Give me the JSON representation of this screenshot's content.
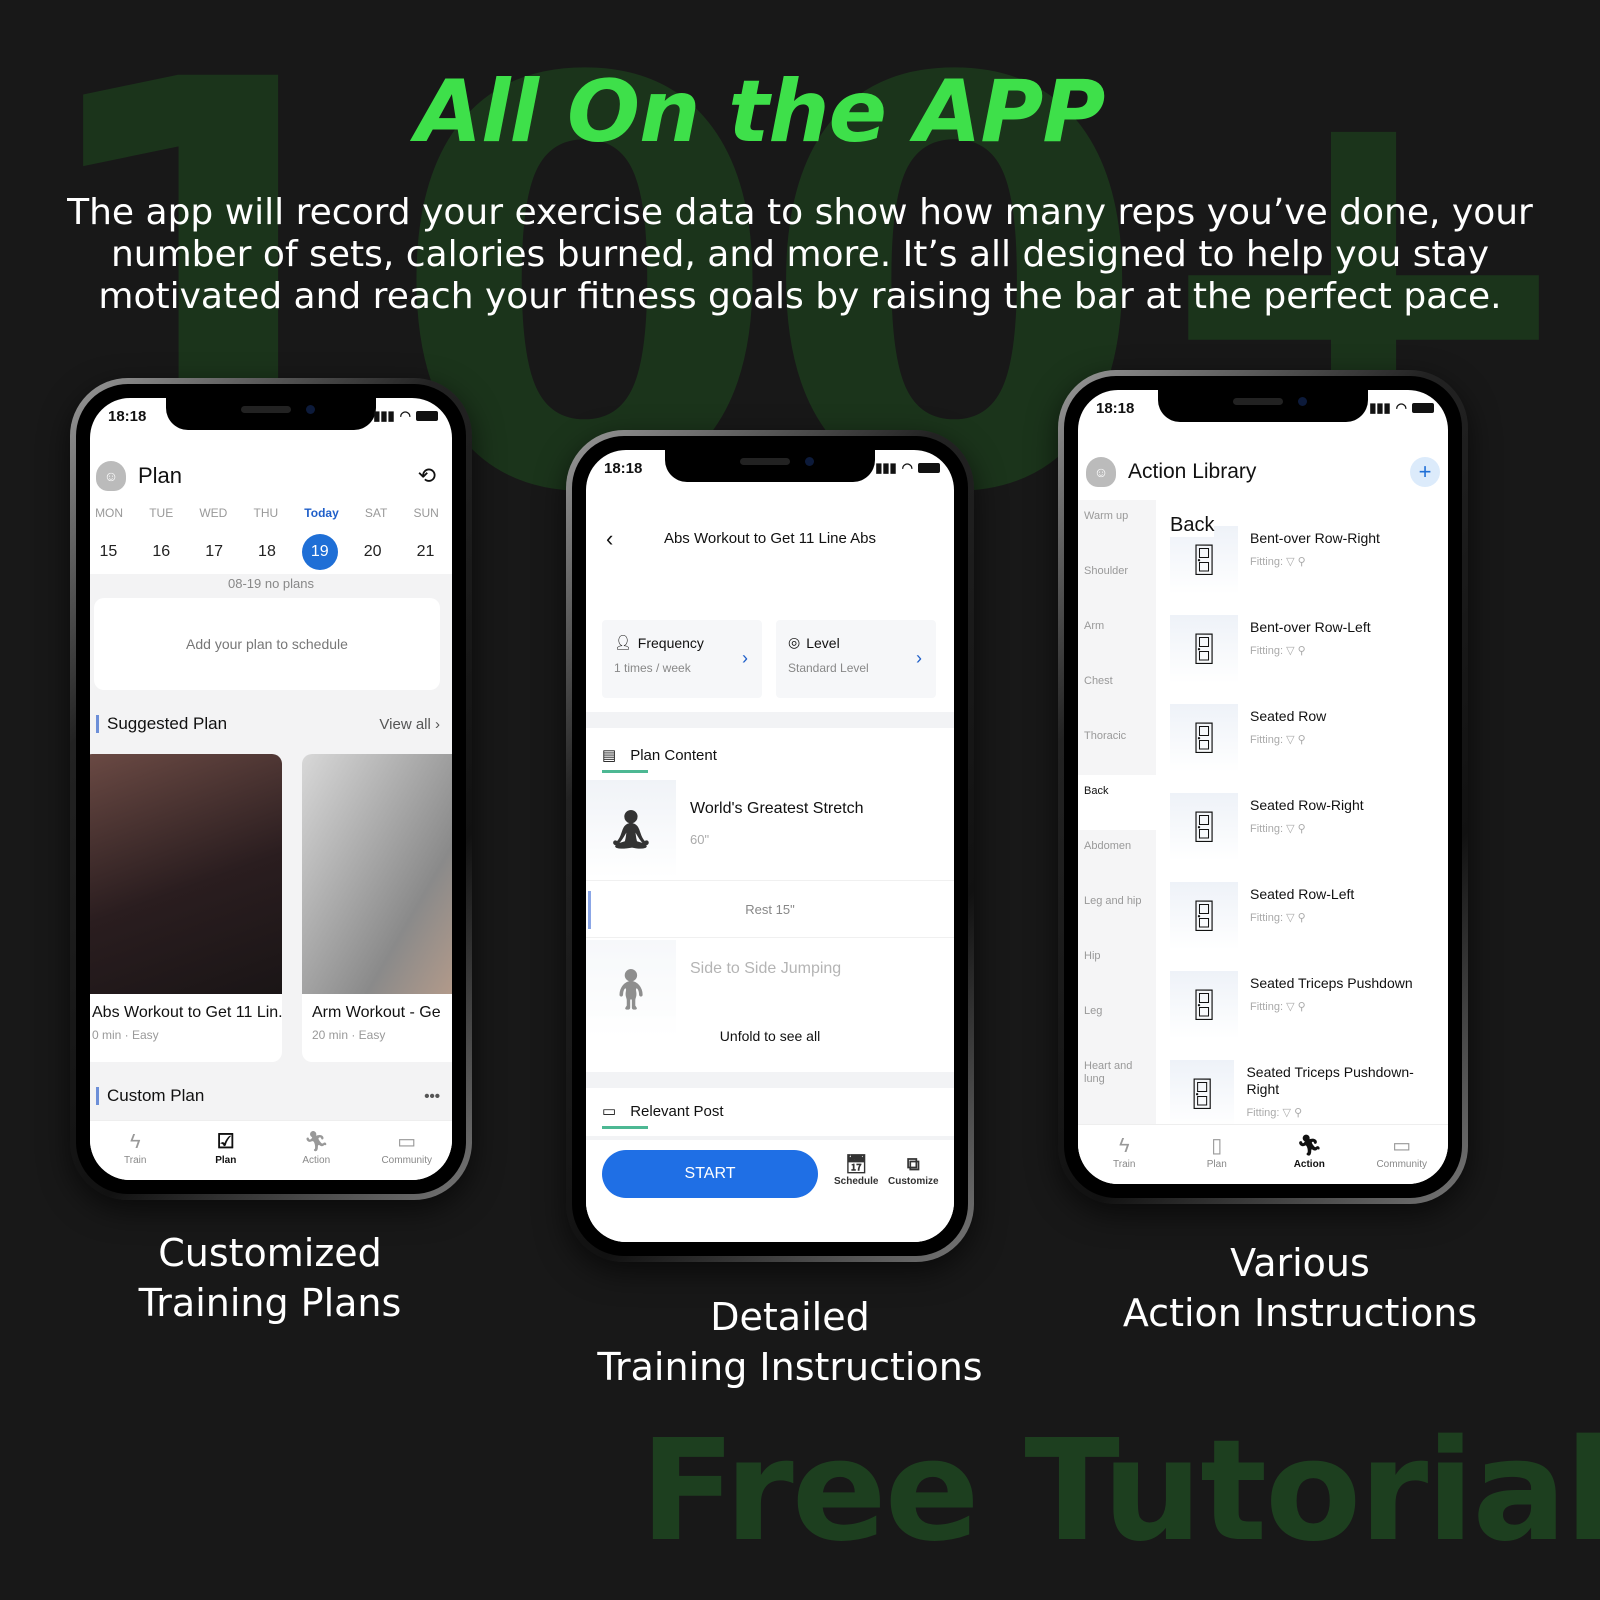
{
  "background": {
    "big_number": "100+",
    "footer_watermark": "Free Tutorials"
  },
  "headline": "All On the APP",
  "description": "The app will record your exercise data to show how many reps you’ve done, your number of sets, calories burned, and more. It’s all designed to help you stay motivated and reach your fitness goals by raising the bar at the perfect pace.",
  "captions": {
    "left": [
      "Customized",
      "Training Plans"
    ],
    "center": [
      "Detailed",
      "Training Instructions"
    ],
    "right": [
      "Various",
      "Action Instructions"
    ]
  },
  "status_bar": {
    "time": "18:18"
  },
  "colors": {
    "accent_green": "#3ee04a",
    "primary_blue": "#1f6fe5",
    "teal_underline": "#4db893"
  },
  "plan_screen": {
    "title": "Plan",
    "weekdays": [
      "MON",
      "TUE",
      "WED",
      "THU",
      "Today",
      "SAT",
      "SUN"
    ],
    "dates": [
      "15",
      "16",
      "17",
      "18",
      "19",
      "20",
      "21"
    ],
    "selected_date": "19",
    "no_plans": "08-19 no plans",
    "add_plan": "Add your plan to schedule",
    "suggested_title": "Suggested Plan",
    "view_all": "View all",
    "cards": [
      {
        "title": "Abs Workout to Get 11 Lin...",
        "meta": "0 min · Easy"
      },
      {
        "title": "Arm Workout - Ge",
        "meta": "20 min · Easy"
      }
    ],
    "custom_title": "Custom Plan",
    "tabs": [
      "Train",
      "Plan",
      "Action",
      "Community"
    ],
    "active_tab": "Plan"
  },
  "detail_screen": {
    "title": "Abs Workout to Get 11 Line Abs",
    "frequency_label": "Frequency",
    "frequency_value": "1 times / week",
    "level_label": "Level",
    "level_value": "Standard Level",
    "plan_content": "Plan Content",
    "exercises": [
      {
        "name": "World's Greatest Stretch",
        "duration": "60\""
      },
      {
        "name": "Side to Side Jumping",
        "duration": ""
      }
    ],
    "rest": "Rest 15\"",
    "unfold": "Unfold to see all",
    "relevant_post": "Relevant Post",
    "start": "START",
    "schedule": "Schedule",
    "customize": "Customize"
  },
  "library_screen": {
    "title": "Action Library",
    "categories": [
      "Warm up",
      "Shoulder",
      "Arm",
      "Chest",
      "Thoracic",
      "Back",
      "Abdomen",
      "Leg and hip",
      "Hip",
      "Leg",
      "Heart and lung"
    ],
    "active_category": "Back",
    "section": "Back",
    "fitting_label": "Fitting:",
    "actions": [
      "Bent-over Row-Right",
      "Bent-over Row-Left",
      "Seated Row",
      "Seated Row-Right",
      "Seated Row-Left",
      "Seated Triceps Pushdown",
      "Seated Triceps Pushdown-Right"
    ],
    "tabs": [
      "Train",
      "Plan",
      "Action",
      "Community"
    ],
    "active_tab": "Action"
  }
}
